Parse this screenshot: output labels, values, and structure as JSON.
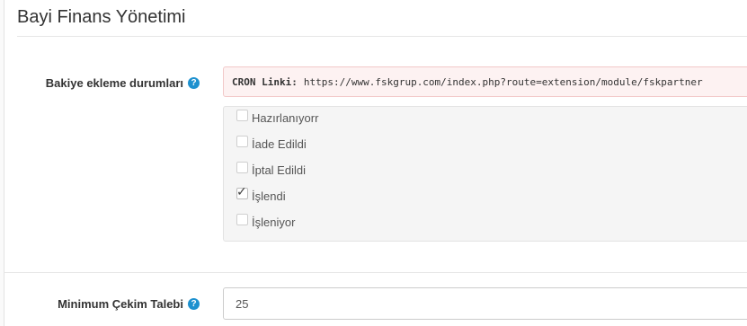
{
  "panel": {
    "title": "Bayi Finans Yönetimi"
  },
  "balance_statuses": {
    "label": "Bakiye ekleme durumları",
    "help_icon": "question-circle-icon",
    "cron_label": "CRON Linki:",
    "cron_url": "https://www.fskgrup.com/index.php?route=extension/module/fskpartner",
    "options": [
      {
        "label": "Hazırlanıyorr",
        "checked": false
      },
      {
        "label": "İade Edildi",
        "checked": false
      },
      {
        "label": "İptal Edildi",
        "checked": false
      },
      {
        "label": "İşlendi",
        "checked": true
      },
      {
        "label": "İşleniyor",
        "checked": false
      }
    ]
  },
  "min_withdrawal": {
    "label": "Minimum Çekim Talebi",
    "help_icon": "question-circle-icon",
    "value": "25"
  },
  "colors": {
    "help_icon": "#1e91cf",
    "alert_bg": "#fdf2f2",
    "well_bg": "#f5f5f5"
  }
}
